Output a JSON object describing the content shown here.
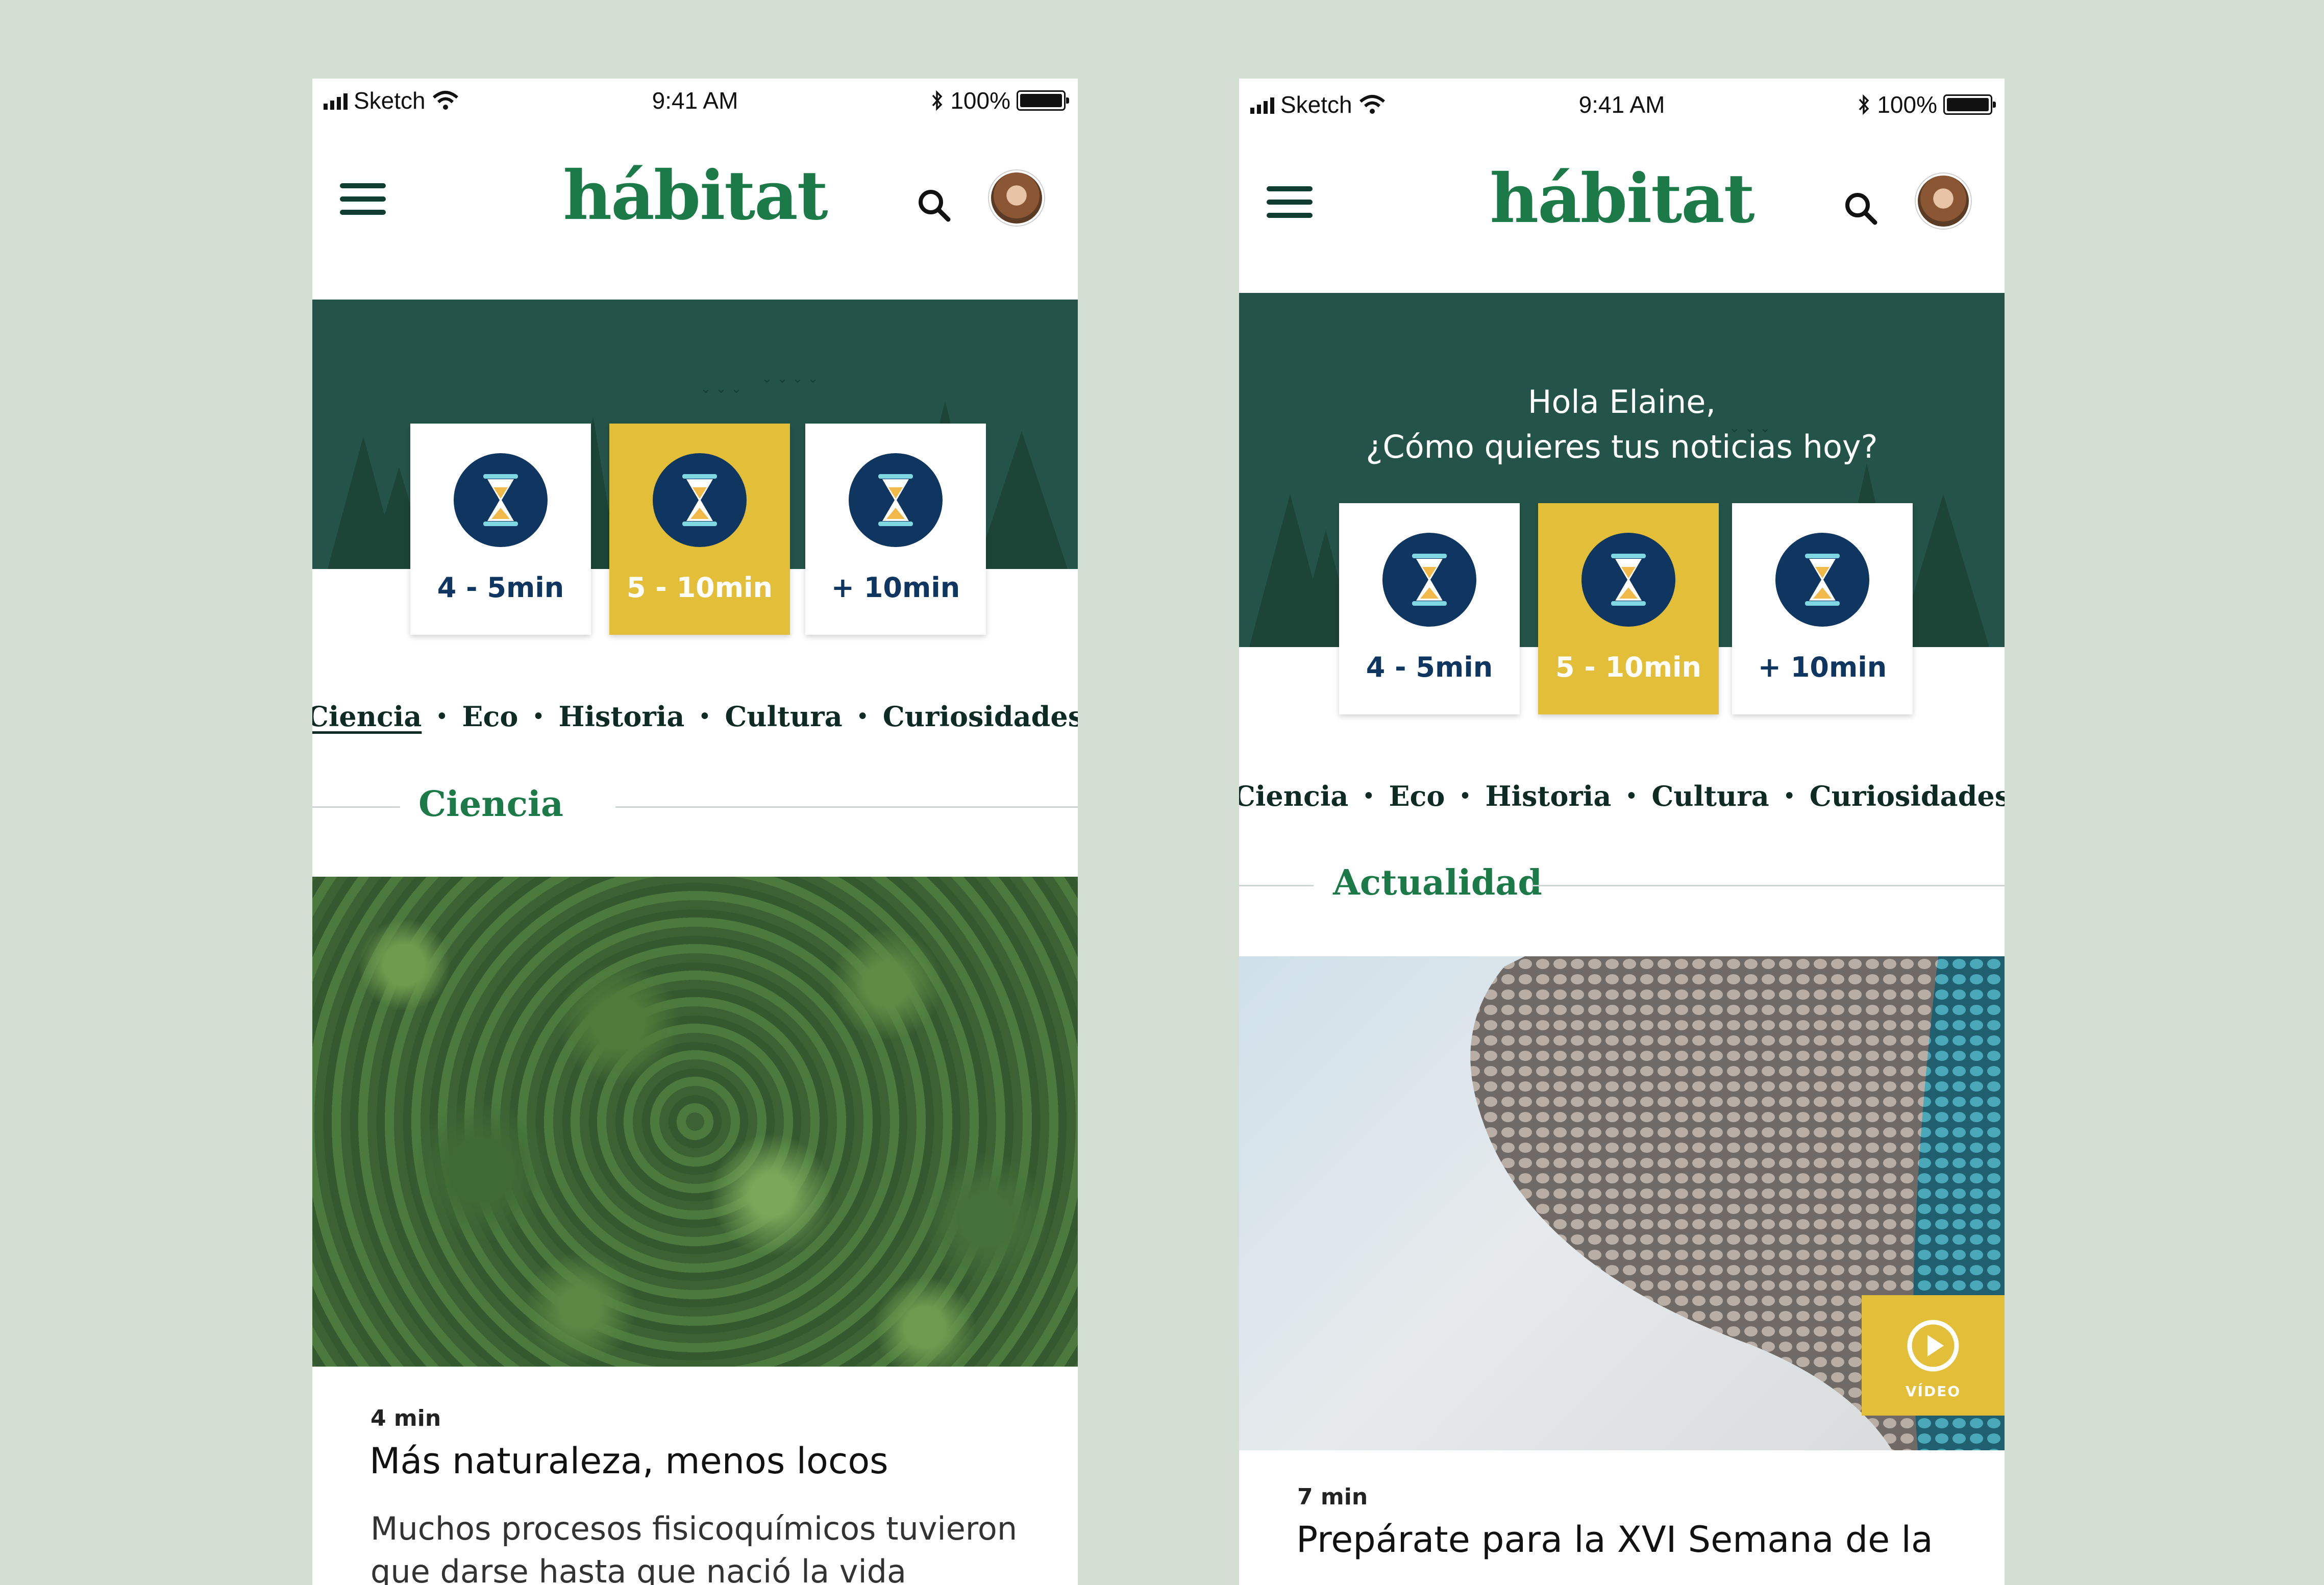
{
  "status_bar": {
    "carrier": "Sketch",
    "time": "9:41 AM",
    "battery": "100%"
  },
  "app": {
    "logo": "hábitat"
  },
  "icons": {
    "menu": "hamburger-menu-icon",
    "search": "search-icon",
    "timer": "hourglass-icon",
    "video": "play-circle-icon"
  },
  "time_options": [
    {
      "label": "4 - 5min",
      "selected": false
    },
    {
      "label": "5 - 10min",
      "selected": true
    },
    {
      "label": "+ 10min",
      "selected": false
    }
  ],
  "categories": [
    "Ciencia",
    "Eco",
    "Historia",
    "Cultura",
    "Curiosidades"
  ],
  "colors": {
    "brand_green": "#1b7a47",
    "dark_green": "#245449",
    "accent_yellow": "#e3bf39",
    "navy": "#0f3561",
    "background": "#d3dfd3"
  },
  "screens": [
    {
      "active_category": "Ciencia",
      "section_title": "Ciencia",
      "article": {
        "read_time": "4 min",
        "title": "Más naturaleza, menos locos",
        "excerpt": "Muchos procesos fisicoquímicos tuvieron que darse hasta que nació la vida"
      }
    },
    {
      "greeting_line1": "Hola Elaine,",
      "greeting_line2": "¿Cómo quieres tus noticias hoy?",
      "section_title": "Actualidad",
      "video_label": "VÍDEO",
      "article": {
        "read_time": "7 min",
        "title": "Prepárate para la XVI Semana de la"
      }
    }
  ]
}
